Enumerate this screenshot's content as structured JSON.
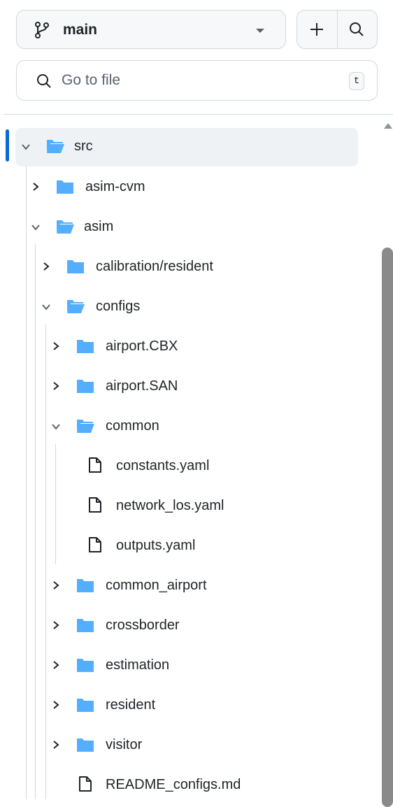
{
  "header": {
    "branch": "main",
    "add_label": "+",
    "search_placeholder": "Go to file",
    "search_shortcut": "t"
  },
  "colors": {
    "folder": "#54aeff",
    "selected_marker": "#0969da",
    "selected_bg": "#eff2f5"
  },
  "tree": [
    {
      "label": "src",
      "type": "folder",
      "expanded": true,
      "selected": true
    },
    {
      "label": "asim-cvm",
      "type": "folder",
      "expanded": false
    },
    {
      "label": "asim",
      "type": "folder",
      "expanded": true
    },
    {
      "label": "calibration/resident",
      "type": "folder",
      "expanded": false
    },
    {
      "label": "configs",
      "type": "folder",
      "expanded": true
    },
    {
      "label": "airport.CBX",
      "type": "folder",
      "expanded": false
    },
    {
      "label": "airport.SAN",
      "type": "folder",
      "expanded": false
    },
    {
      "label": "common",
      "type": "folder",
      "expanded": true
    },
    {
      "label": "constants.yaml",
      "type": "file"
    },
    {
      "label": "network_los.yaml",
      "type": "file"
    },
    {
      "label": "outputs.yaml",
      "type": "file"
    },
    {
      "label": "common_airport",
      "type": "folder",
      "expanded": false
    },
    {
      "label": "crossborder",
      "type": "folder",
      "expanded": false
    },
    {
      "label": "estimation",
      "type": "folder",
      "expanded": false
    },
    {
      "label": "resident",
      "type": "folder",
      "expanded": false
    },
    {
      "label": "visitor",
      "type": "folder",
      "expanded": false
    },
    {
      "label": "README_configs.md",
      "type": "file"
    }
  ]
}
